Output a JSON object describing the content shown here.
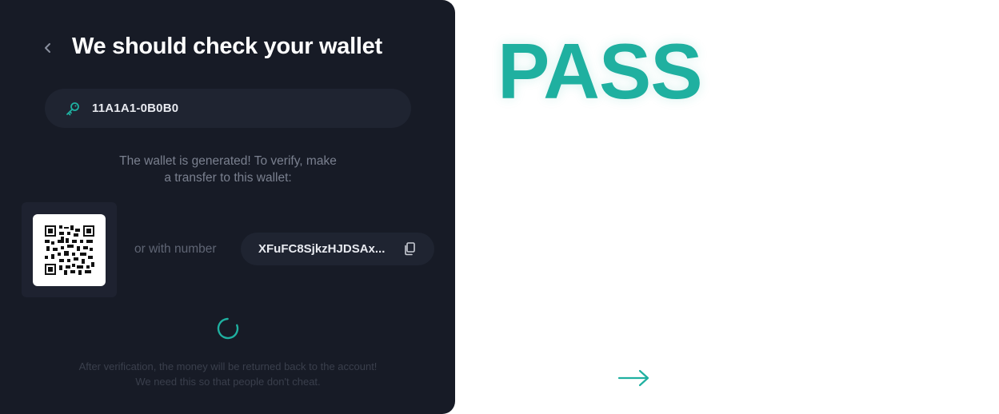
{
  "dialog": {
    "title": "We should check your wallet",
    "key_value": "11A1A1-0B0B0",
    "info_line1": "The wallet is generated! To verify, make",
    "info_line2": "a transfer to this wallet:",
    "or_with_number": "or with number",
    "wallet_address": "XFuFC8SjkzHJDSAx...",
    "footnote_line1": "After verification, the money will be returned back to the account!",
    "footnote_line2": "We need this so that people don't cheat."
  },
  "status": {
    "result_label": "PASS"
  },
  "icons": {
    "back": "chevron-left-icon",
    "key": "key-icon",
    "qr": "qr-code-icon",
    "copy": "copy-icon",
    "spinner": "loading-spinner-icon",
    "next": "arrow-right-icon"
  },
  "colors": {
    "card_background": "#171b26",
    "field_background": "#1f2431",
    "accent": "#1fb0a0",
    "pass": "#1fb0a0",
    "muted_text": "#7a808f"
  }
}
